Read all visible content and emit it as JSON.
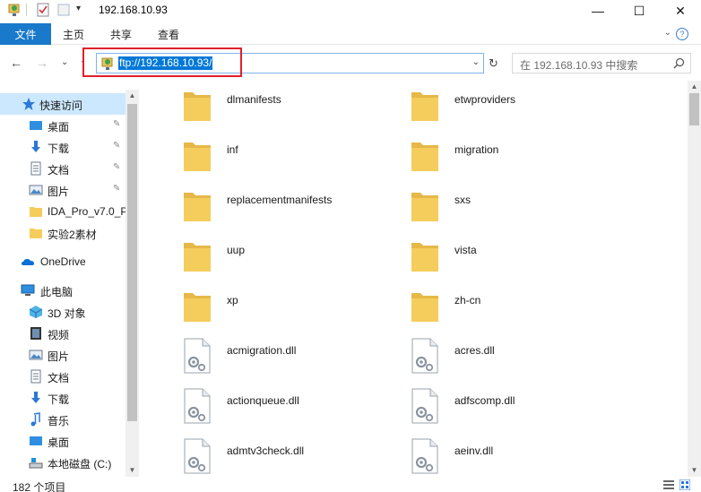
{
  "window": {
    "title": "192.168.10.93",
    "quick_access_dropdown": "▾",
    "minimize": "—",
    "maximize": "☐",
    "close": "✕"
  },
  "ribbon": {
    "tabs": [
      "文件",
      "主页",
      "共享",
      "查看"
    ],
    "help": "?",
    "collapse": "⌄"
  },
  "nav": {
    "back": "←",
    "forward": "→",
    "recent": "⌄",
    "up": "↑",
    "address": "ftp://192.168.10.93/",
    "address_dropdown": "⌄",
    "refresh": "↻",
    "search_placeholder": "在 192.168.10.93 中搜索"
  },
  "sidebar": {
    "quick_access": "快速访问",
    "quick_items": [
      {
        "label": "桌面",
        "icon": "desktop-icon",
        "pinned": true
      },
      {
        "label": "下载",
        "icon": "download-icon",
        "pinned": true
      },
      {
        "label": "文档",
        "icon": "document-icon",
        "pinned": true
      },
      {
        "label": "图片",
        "icon": "picture-icon",
        "pinned": true
      },
      {
        "label": "IDA_Pro_v7.0_P",
        "icon": "folder-icon",
        "pinned": false
      },
      {
        "label": "实验2素材",
        "icon": "folder-icon",
        "pinned": false
      }
    ],
    "onedrive": "OneDrive",
    "this_pc": "此电脑",
    "pc_items": [
      {
        "label": "3D 对象",
        "icon": "3d-objects-icon"
      },
      {
        "label": "视频",
        "icon": "video-icon"
      },
      {
        "label": "图片",
        "icon": "picture-icon"
      },
      {
        "label": "文档",
        "icon": "document-icon"
      },
      {
        "label": "下载",
        "icon": "download-icon"
      },
      {
        "label": "音乐",
        "icon": "music-icon"
      },
      {
        "label": "桌面",
        "icon": "desktop-icon"
      },
      {
        "label": "本地磁盘 (C:)",
        "icon": "drive-icon"
      }
    ],
    "pin_glyph": "📌"
  },
  "files": [
    {
      "name": "dlmanifests",
      "type": "folder"
    },
    {
      "name": "etwproviders",
      "type": "folder"
    },
    {
      "name": "inf",
      "type": "folder"
    },
    {
      "name": "migration",
      "type": "folder"
    },
    {
      "name": "replacementmanifests",
      "type": "folder"
    },
    {
      "name": "sxs",
      "type": "folder"
    },
    {
      "name": "uup",
      "type": "folder"
    },
    {
      "name": "vista",
      "type": "folder"
    },
    {
      "name": "xp",
      "type": "folder"
    },
    {
      "name": "zh-cn",
      "type": "folder"
    },
    {
      "name": "acmigration.dll",
      "type": "dll"
    },
    {
      "name": "acres.dll",
      "type": "dll"
    },
    {
      "name": "actionqueue.dll",
      "type": "dll"
    },
    {
      "name": "adfscomp.dll",
      "type": "dll"
    },
    {
      "name": "admtv3check.dll",
      "type": "dll"
    },
    {
      "name": "aeinv.dll",
      "type": "dll"
    }
  ],
  "status": {
    "item_count": "182 个项目"
  },
  "colors": {
    "accent": "#1979ca",
    "selection": "#0078d7",
    "highlight_box": "#e0202a",
    "folder": "#f5cd5c"
  }
}
